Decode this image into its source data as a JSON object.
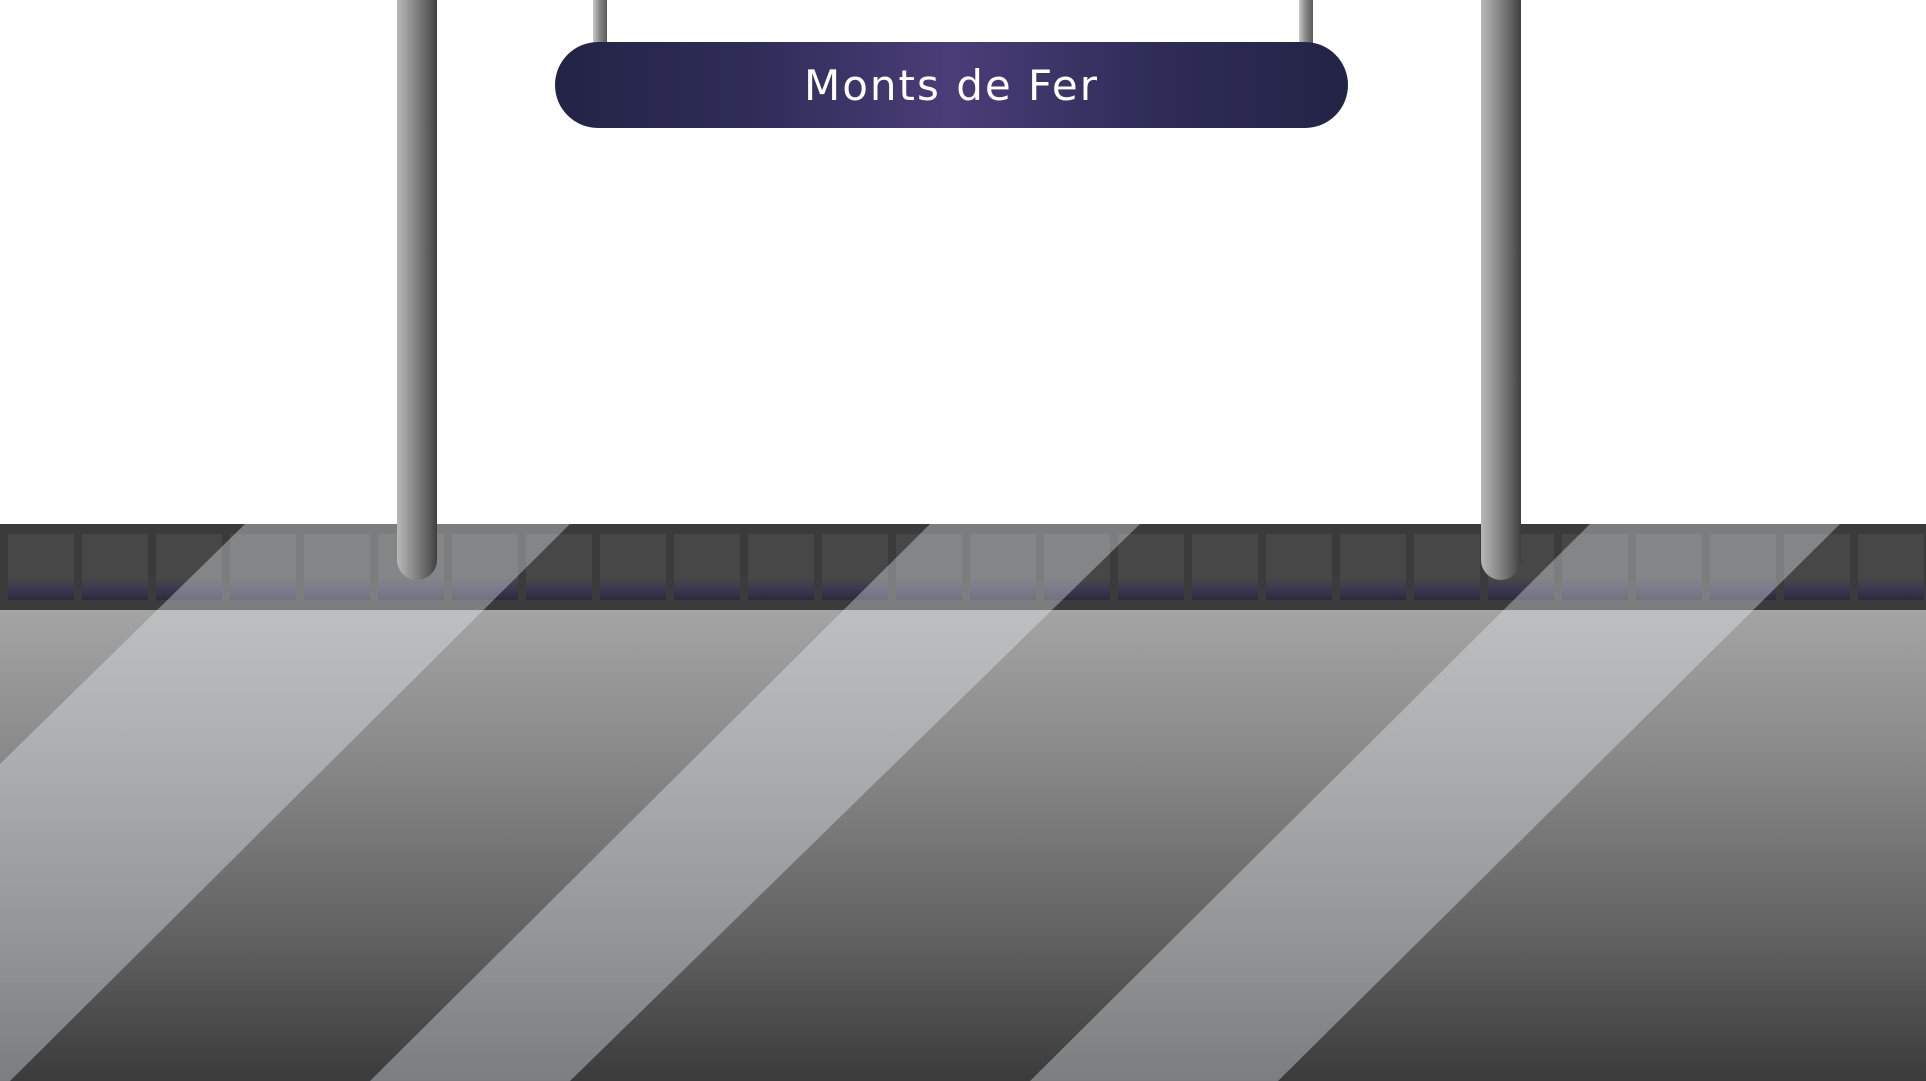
{
  "station": {
    "name": "Monts de Fer"
  },
  "colors": {
    "sign_dark": "#232346",
    "sign_light": "#4a3d78",
    "sign_text": "#ffffff",
    "window_band": "#3b3b3b",
    "body_top": "#a4a4a4",
    "body_bottom": "#3b3b3b",
    "stripe": "#e6eaee"
  },
  "train": {
    "window_count": 27
  }
}
